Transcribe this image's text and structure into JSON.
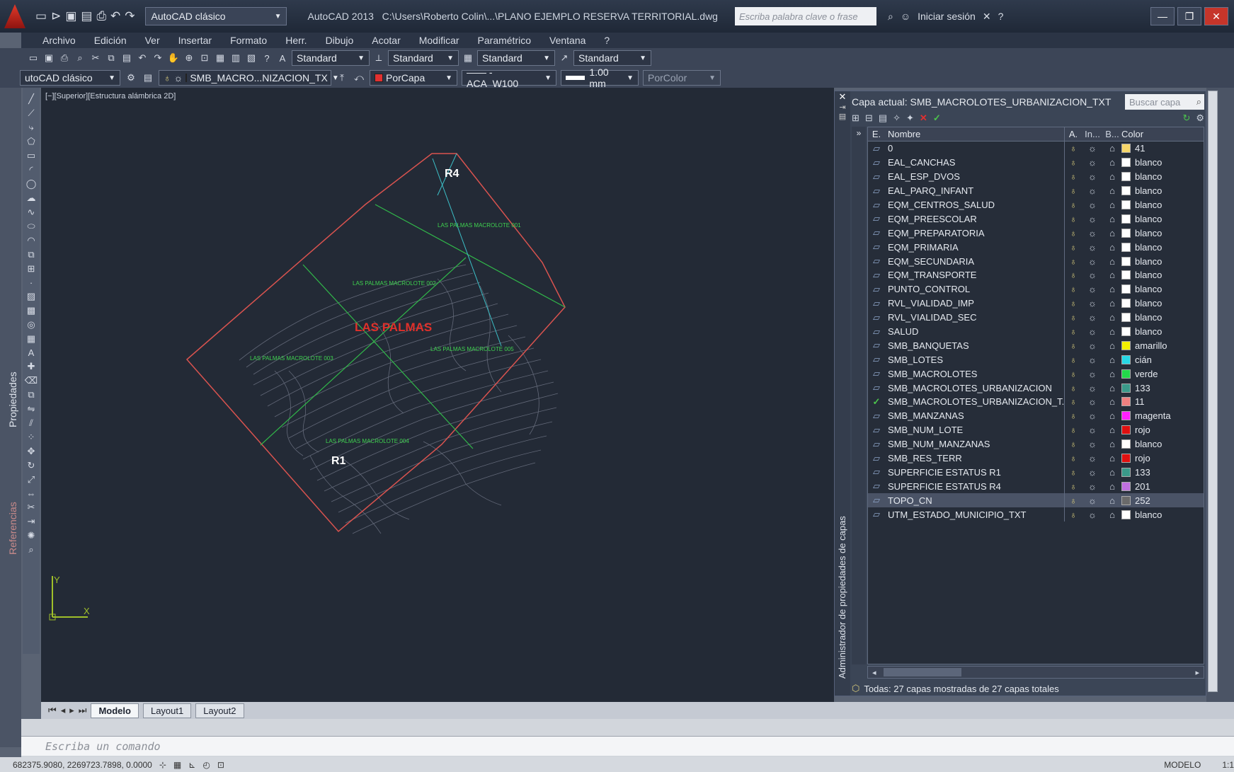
{
  "titlebar": {
    "workspace": "AutoCAD clásico",
    "app_version": "AutoCAD 2013",
    "file_path": "C:\\Users\\Roberto Colin\\...\\PLANO EJEMPLO RESERVA TERRITORIAL.dwg",
    "search_placeholder": "Escriba palabra clave o frase",
    "signin_label": "Iniciar sesión"
  },
  "menu": [
    "Archivo",
    "Edición",
    "Ver",
    "Insertar",
    "Formato",
    "Herr.",
    "Dibujo",
    "Acotar",
    "Modificar",
    "Paramétrico",
    "Ventana",
    "?"
  ],
  "toolbar1": {
    "text_style": "Standard",
    "dim_style": "Standard",
    "table_style": "Standard",
    "mleader_style": "Standard"
  },
  "toolbar2": {
    "workspace": "utoCAD clásico",
    "layer": "SMB_MACRO...NIZACION_TX",
    "color": "PorCapa",
    "linetype": "—— - ACA_W100",
    "lineweight": "1.00 mm",
    "plotstyle": "PorColor"
  },
  "side_tabs": {
    "properties": "Propiedades",
    "references": "Referencias"
  },
  "viewport": {
    "label": "[−][Superior][Estructura alámbrica 2D]",
    "title_text": "LAS PALMAS",
    "labels": {
      "r4": "R4",
      "r1": "R1",
      "lote1": "LAS PALMAS MACROLOTE 001",
      "lote2": "LAS PALMAS MACROLOTE 002",
      "lote3": "LAS PALMAS MACROLOTE 003",
      "lote4": "LAS PALMAS MACROLOTE 004",
      "lote5": "LAS PALMAS MACROLOTE 005"
    },
    "ucs_x": "X",
    "ucs_y": "Y"
  },
  "tabs": [
    "Modelo",
    "Layout1",
    "Layout2"
  ],
  "command_placeholder": "Escriba un comando",
  "status": {
    "coords": "682375.9080, 2269723.7898, 0.0000",
    "model": "MODELO",
    "scale": "1:1"
  },
  "layer_palette": {
    "title": "Administrador de propiedades de capas",
    "current_layer": "Capa actual: SMB_MACROLOTES_URBANIZACION_TXT",
    "search_placeholder": "Buscar capa",
    "columns": {
      "status": "E.",
      "name": "Nombre",
      "on": "A.",
      "freeze": "In...",
      "lock": "B...",
      "color": "Color"
    },
    "footer": "Todas: 27 capas mostradas de 27 capas totales",
    "layers": [
      {
        "name": "0",
        "color": "41",
        "hex": "#f6d66a"
      },
      {
        "name": "EAL_CANCHAS",
        "color": "blanco",
        "hex": "#ffffff"
      },
      {
        "name": "EAL_ESP_DVOS",
        "color": "blanco",
        "hex": "#ffffff"
      },
      {
        "name": "EAL_PARQ_INFANT",
        "color": "blanco",
        "hex": "#ffffff"
      },
      {
        "name": "EQM_CENTROS_SALUD",
        "color": "blanco",
        "hex": "#ffffff"
      },
      {
        "name": "EQM_PREESCOLAR",
        "color": "blanco",
        "hex": "#ffffff"
      },
      {
        "name": "EQM_PREPARATORIA",
        "color": "blanco",
        "hex": "#ffffff"
      },
      {
        "name": "EQM_PRIMARIA",
        "color": "blanco",
        "hex": "#ffffff"
      },
      {
        "name": "EQM_SECUNDARIA",
        "color": "blanco",
        "hex": "#ffffff"
      },
      {
        "name": "EQM_TRANSPORTE",
        "color": "blanco",
        "hex": "#ffffff"
      },
      {
        "name": "PUNTO_CONTROL",
        "color": "blanco",
        "hex": "#ffffff"
      },
      {
        "name": "RVL_VIALIDAD_IMP",
        "color": "blanco",
        "hex": "#ffffff"
      },
      {
        "name": "RVL_VIALIDAD_SEC",
        "color": "blanco",
        "hex": "#ffffff"
      },
      {
        "name": "SALUD",
        "color": "blanco",
        "hex": "#ffffff"
      },
      {
        "name": "SMB_BANQUETAS",
        "color": "amarillo",
        "hex": "#f4f000"
      },
      {
        "name": "SMB_LOTES",
        "color": "cián",
        "hex": "#27d8e6"
      },
      {
        "name": "SMB_MACROLOTES",
        "color": "verde",
        "hex": "#22d84a"
      },
      {
        "name": "SMB_MACROLOTES_URBANIZACION",
        "color": "133",
        "hex": "#3a9a8a"
      },
      {
        "name": "SMB_MACROLOTES_URBANIZACION_T...",
        "color": "11",
        "hex": "#f08080",
        "current": true
      },
      {
        "name": "SMB_MANZANAS",
        "color": "magenta",
        "hex": "#ff20ff"
      },
      {
        "name": "SMB_NUM_LOTE",
        "color": "rojo",
        "hex": "#e01010"
      },
      {
        "name": "SMB_NUM_MANZANAS",
        "color": "blanco",
        "hex": "#ffffff"
      },
      {
        "name": "SMB_RES_TERR",
        "color": "rojo",
        "hex": "#e01010"
      },
      {
        "name": "SUPERFICIE ESTATUS R1",
        "color": "133",
        "hex": "#3a9a8a"
      },
      {
        "name": "SUPERFICIE ESTATUS R4",
        "color": "201",
        "hex": "#c070e0"
      },
      {
        "name": "TOPO_CN",
        "color": "252",
        "hex": "#6a6a6a",
        "selected": true
      },
      {
        "name": "UTM_ESTADO_MUNICIPIO_TXT",
        "color": "blanco",
        "hex": "#ffffff"
      }
    ]
  }
}
